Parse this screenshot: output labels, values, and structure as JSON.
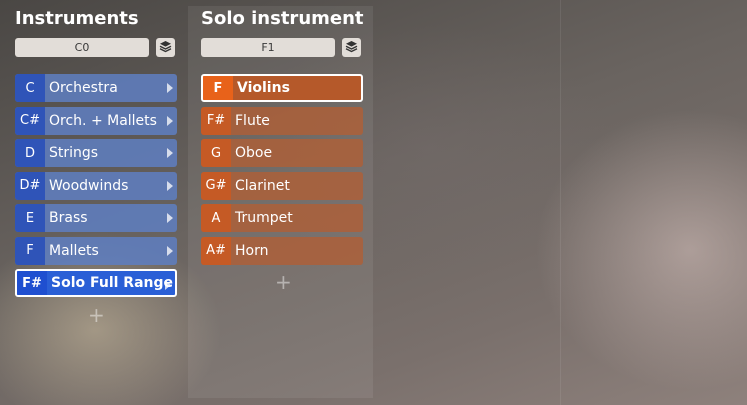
{
  "instruments": {
    "title": "Instruments",
    "key_value": "C0",
    "items": [
      {
        "key": "C",
        "label": "Orchestra"
      },
      {
        "key": "C#",
        "label": "Orch. + Mallets"
      },
      {
        "key": "D",
        "label": "Strings"
      },
      {
        "key": "D#",
        "label": "Woodwinds"
      },
      {
        "key": "E",
        "label": "Brass"
      },
      {
        "key": "F",
        "label": "Mallets"
      },
      {
        "key": "F#",
        "label": "Solo Full Range"
      }
    ],
    "add_symbol": "+"
  },
  "solo_instrument": {
    "title": "Solo instrument",
    "key_value": "F1",
    "items": [
      {
        "key": "F",
        "label": "Violins"
      },
      {
        "key": "F#",
        "label": "Flute"
      },
      {
        "key": "G",
        "label": "Oboe"
      },
      {
        "key": "G#",
        "label": "Clarinet"
      },
      {
        "key": "A",
        "label": "Trumpet"
      },
      {
        "key": "A#",
        "label": "Horn"
      }
    ],
    "add_symbol": "+"
  },
  "colors": {
    "instrument_accent": "#2f54b8",
    "solo_accent": "#e8621a"
  },
  "icons": {
    "stack": "stack-icon",
    "arrow": "chevron-right-icon",
    "add": "plus-icon"
  }
}
